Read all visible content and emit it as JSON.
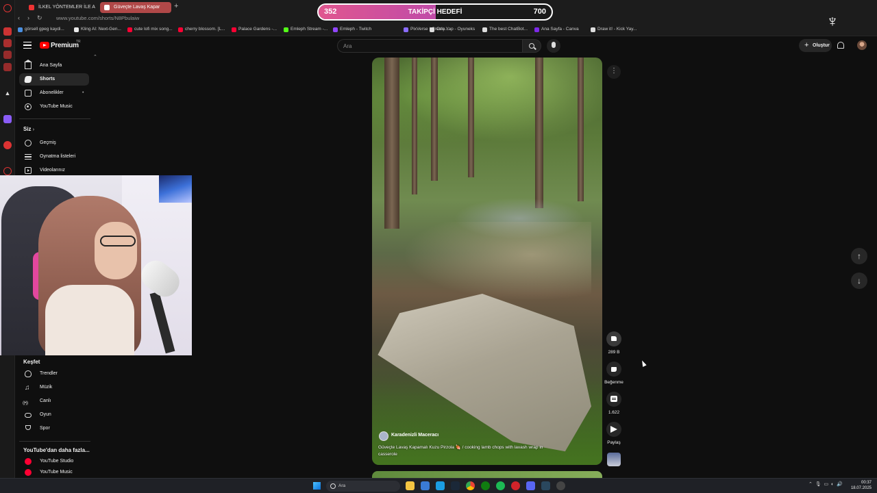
{
  "browser": {
    "tabs": [
      {
        "label": "İLKEL YÖNTEMLER İLE A"
      },
      {
        "label": "Güveçte Lavaş Kapar"
      }
    ],
    "url": "www.youtube.com/shorts/N8Pbulaiw",
    "bookmarks": [
      {
        "label": "görsell gpeg kaydi...",
        "color": "#4a90e2"
      },
      {
        "label": "Kling AI: Next-Gen...",
        "color": "#eaeaea"
      },
      {
        "label": "cute lofi mix song...",
        "color": "#f03"
      },
      {
        "label": "cherry blossom. [L...",
        "color": "#f03"
      },
      {
        "label": "Palace Gardens -...",
        "color": "#f03"
      },
      {
        "label": "Emleph Stream -...",
        "color": "#53fc18"
      },
      {
        "label": "Emleph - Twitch",
        "color": "#9146ff"
      },
      {
        "label": "PixVerse | Create...",
        "color": "#8a6cff"
      },
      {
        "label": "Oriş Yap - Oyuneks",
        "color": "#ddd"
      },
      {
        "label": "The best ChatBot...",
        "color": "#ddd"
      },
      {
        "label": "Ana Sayfa - Canva",
        "color": "#7d2ae8"
      },
      {
        "label": "Draw it! - Kick Yay...",
        "color": "#ddd"
      }
    ]
  },
  "overlay": {
    "follower_current": "352",
    "follower_title": "TAKİPÇİ HEDEFİ",
    "follower_goal": "700",
    "follower_progress": 0.503
  },
  "header": {
    "brand": "Premium",
    "brand_sup": "TR",
    "search_placeholder": "Ara",
    "create_label": "Oluştur"
  },
  "sidebar": {
    "main": [
      {
        "label": "Ana Sayfa",
        "icon": "home-icon"
      },
      {
        "label": "Shorts",
        "icon": "shorts-icon"
      },
      {
        "label": "Abonelikler",
        "icon": "subscriptions-icon"
      },
      {
        "label": "YouTube Music",
        "icon": "youtube-music-icon"
      }
    ],
    "you_title": "Siz",
    "you": [
      {
        "label": "Geçmiş",
        "icon": "history-icon"
      },
      {
        "label": "Oynatma listeleri",
        "icon": "playlists-icon"
      },
      {
        "label": "Videolarınız",
        "icon": "your-videos-icon"
      }
    ],
    "explore_title": "Keşfet",
    "explore": [
      {
        "label": "Trendler",
        "icon": "trending-icon"
      },
      {
        "label": "Müzik",
        "icon": "music-icon"
      },
      {
        "label": "Canlı",
        "icon": "live-icon"
      },
      {
        "label": "Oyun",
        "icon": "gaming-icon"
      },
      {
        "label": "Spor",
        "icon": "trophy-icon"
      }
    ],
    "more_title": "YouTube'dan daha fazla...",
    "more": [
      {
        "label": "YouTube Studio",
        "icon": "youtube-studio-icon"
      },
      {
        "label": "YouTube Music",
        "icon": "youtube-music-icon"
      }
    ]
  },
  "video": {
    "channel": "Karadenizli Maceracı",
    "caption": "Güveçte Lavaş Kapamalı Kuzu Pirzola 🍖 / cooking lamb chops with lavash wrap in casserole",
    "likes": "289 B",
    "dislike_label": "Beğenme",
    "comments": "1.622",
    "share_label": "Paylaş"
  },
  "taskbar": {
    "search_label": "Ara",
    "time": "00:37",
    "date": "18.07.2025"
  }
}
